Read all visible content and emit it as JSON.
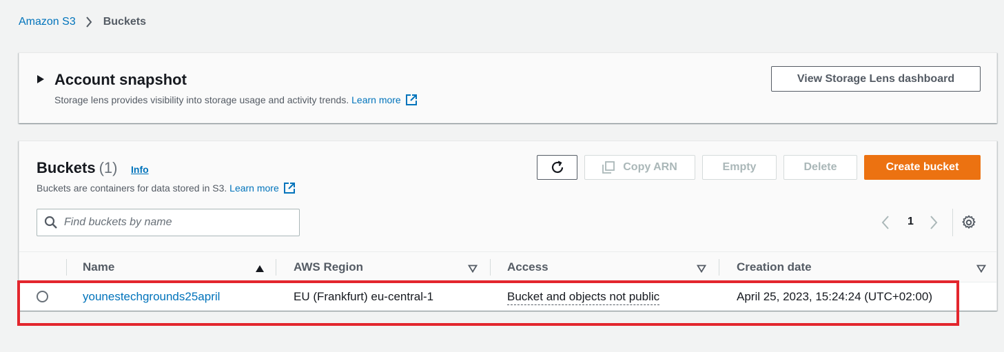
{
  "breadcrumb": {
    "root": "Amazon S3",
    "current": "Buckets"
  },
  "snapshot": {
    "title": "Account snapshot",
    "description": "Storage lens provides visibility into storage usage and activity trends.",
    "learn_more": "Learn more",
    "storage_lens_button": "View Storage Lens dashboard"
  },
  "buckets": {
    "title": "Buckets",
    "count": "(1)",
    "info": "Info",
    "description": "Buckets are containers for data stored in S3.",
    "learn_more": "Learn more",
    "actions": {
      "copy_arn": "Copy ARN",
      "empty": "Empty",
      "delete": "Delete",
      "create": "Create bucket"
    },
    "search_placeholder": "Find buckets by name",
    "page": "1",
    "columns": {
      "name": "Name",
      "region": "AWS Region",
      "access": "Access",
      "created": "Creation date"
    },
    "rows": [
      {
        "name": "younestechgrounds25april",
        "region": "EU (Frankfurt) eu-central-1",
        "access": "Bucket and objects not public",
        "created": "April 25, 2023, 15:24:24 (UTC+02:00)"
      }
    ]
  },
  "colors": {
    "link": "#0073bb",
    "primary_button": "#ec7211",
    "highlight_box": "#e3262d",
    "background": "#f2f3f3"
  }
}
